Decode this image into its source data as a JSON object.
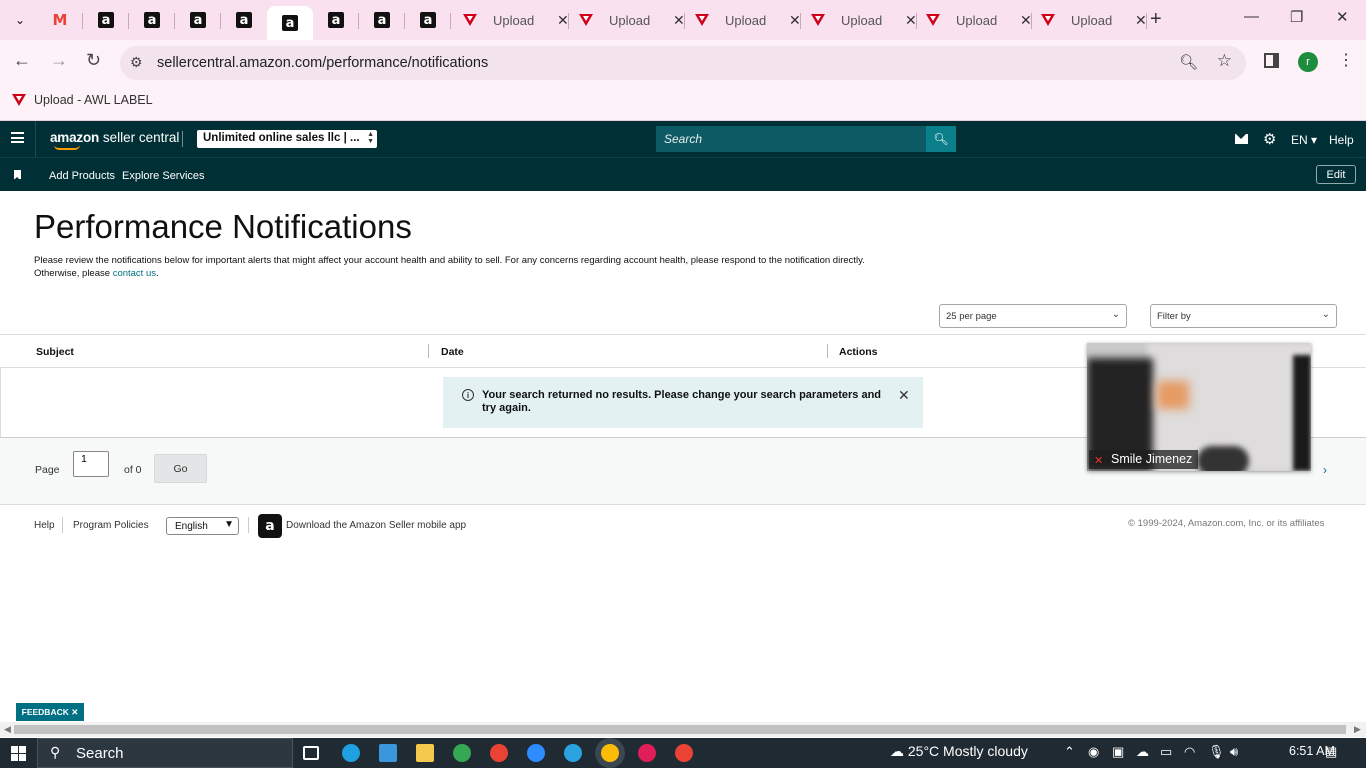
{
  "browser": {
    "tabs_pinned_count": 9,
    "upload_tabs": [
      {
        "title": "Upload"
      },
      {
        "title": "Upload"
      },
      {
        "title": "Upload"
      },
      {
        "title": "Upload"
      },
      {
        "title": "Upload"
      },
      {
        "title": "Upload"
      }
    ],
    "url": "sellercentral.amazon.com/performance/notifications",
    "profile_initial": "r",
    "bookmark_label": "Upload - AWL LABEL"
  },
  "header": {
    "logo_bold": "amazon",
    "logo_text": " seller central",
    "account": "Unlimited online sales llc | ...",
    "search_placeholder": "Search",
    "language": "EN",
    "help": "Help"
  },
  "subnav": {
    "links": [
      "Add Products",
      "Explore Services"
    ],
    "edit": "Edit"
  },
  "page": {
    "title": "Performance Notifications",
    "description_1": "Please review the notifications below for important alerts that might affect your account health and ability to sell. For any concerns regarding account health, please respond to the notification directly.",
    "description_2": "Otherwise, please ",
    "contact_link": "contact us",
    "description_end": ".",
    "per_page": "25 per page",
    "filter": "Filter by"
  },
  "table": {
    "headers": [
      "Subject",
      "Date",
      "Actions"
    ],
    "empty_message": "Your search returned no results. Please change your search parameters and try again."
  },
  "pager": {
    "page_label": "Page",
    "page_value": "1",
    "of_label": "of 0",
    "go": "Go"
  },
  "footer": {
    "help": "Help",
    "policies": "Program Policies",
    "language": "English",
    "app_link": "Download the Amazon Seller mobile app",
    "copyright": "© 1999-2024, Amazon.com, Inc. or its affiliates"
  },
  "video": {
    "participant": "Smile Jimenez"
  },
  "feedback": "FEEDBACK ✕",
  "taskbar": {
    "search": "Search",
    "weather": "25°C  Mostly cloudy",
    "time": "6:51 AM"
  },
  "colors": {
    "header_bg": "#002f36",
    "link": "#007185",
    "alert_bg": "#e3f1f2",
    "browser_tab_bg": "#f9e1ef"
  }
}
